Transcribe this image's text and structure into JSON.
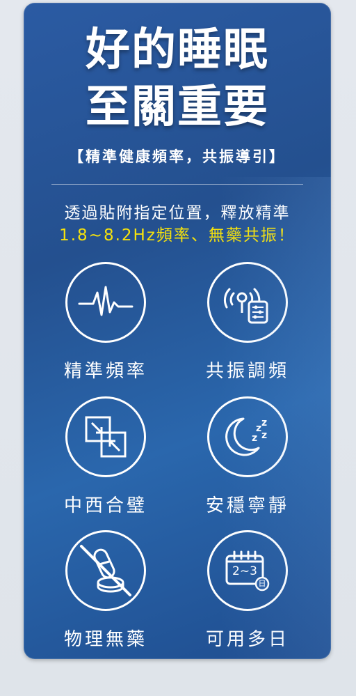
{
  "headline": {
    "line1": "好的睡眠",
    "line2": "至關重要"
  },
  "subtitle": "【精準健康頻率，共振導引】",
  "description": {
    "line1": "透過貼附指定位置，釋放精準",
    "line2": "1.8~8.2Hz頻率、無藥共振！",
    "highlight_color": "#f6e20c"
  },
  "features": [
    {
      "label": "精準頻率",
      "icon": "heartbeat-icon"
    },
    {
      "label": "共振調頻",
      "icon": "signal-device-icon"
    },
    {
      "label": "中西合璧",
      "icon": "merge-arrows-icon"
    },
    {
      "label": "安穩寧靜",
      "icon": "moon-sleep-icon"
    },
    {
      "label": "物理無藥",
      "icon": "no-pills-icon"
    },
    {
      "label": "可用多日",
      "icon": "calendar-days-icon"
    }
  ],
  "calendar_text": "2~3",
  "calendar_badge": "日",
  "colors": {
    "card_background": "#2b5ba3",
    "page_background": "#e4e8ee",
    "text": "#ffffff"
  }
}
